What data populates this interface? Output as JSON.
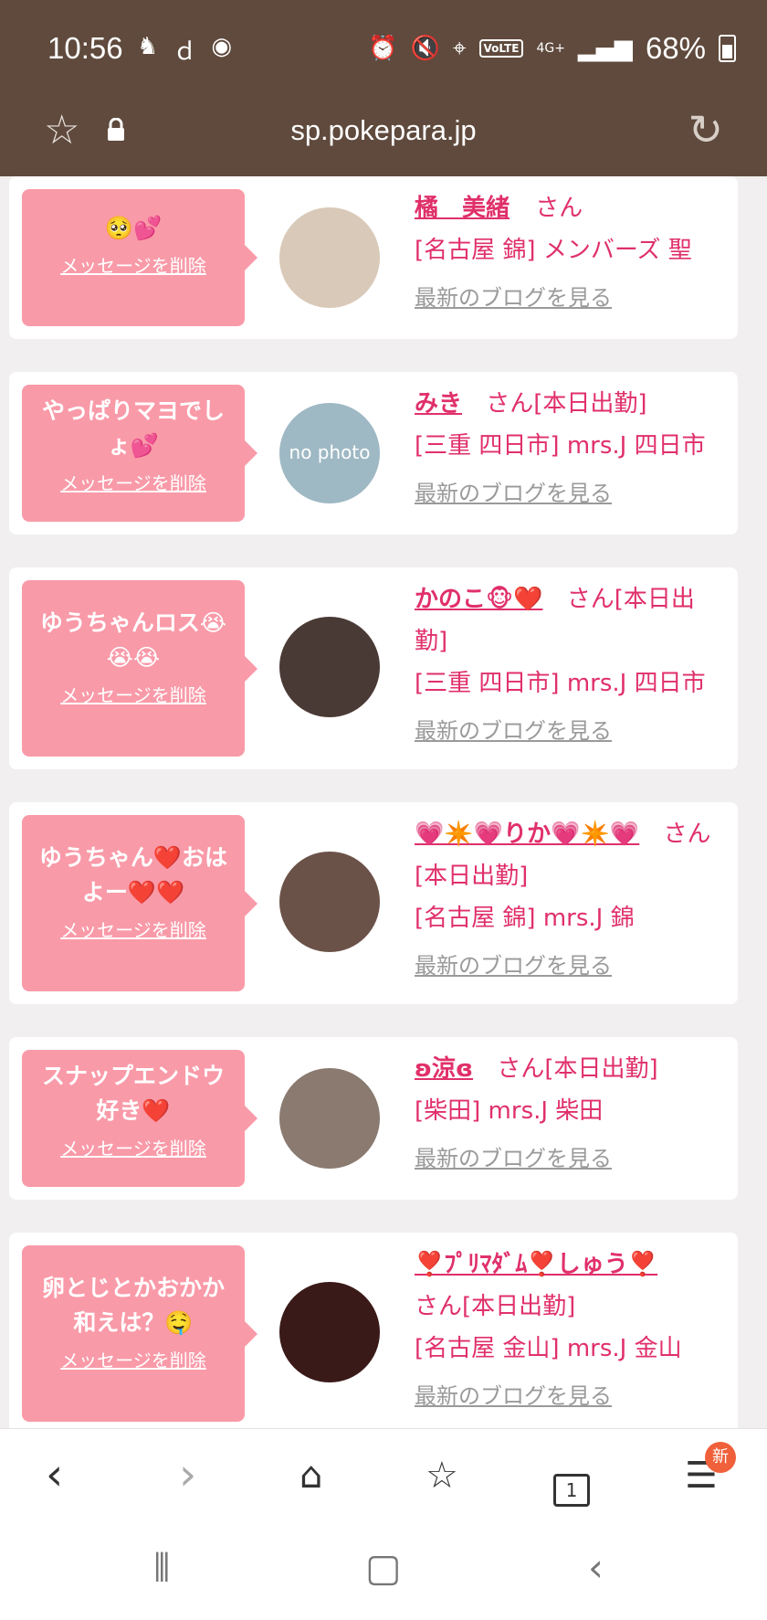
{
  "status": {
    "time": "10:56",
    "volte": "VoLTE",
    "network": "4G+",
    "battery": "68%"
  },
  "browser": {
    "url": "sp.pokepara.jp",
    "tab_count": "1",
    "menu_badge": "新"
  },
  "delete_label": "メッセージを削除",
  "blog_label": "最新のブログを見る",
  "san": "さん",
  "entries": [
    {
      "message": "🥺💕",
      "name": "橘　美緒",
      "name_tail": "さん",
      "shop": "[名古屋 錦] メンバーズ 聖",
      "avatar_color": "#d9c9b8",
      "avatar_text": ""
    },
    {
      "message": "やっぱりマヨでしょ💕",
      "name": "みき",
      "name_tail": "さん[本日出勤]",
      "shop": "[三重 四日市] mrs.J 四日市",
      "avatar_color": "#9eb8c4",
      "avatar_text": "no photo"
    },
    {
      "message": "ゆうちゃんロス😭😭😭",
      "name": "かのこ🐵❤️",
      "name_tail": "さん[本日出勤]",
      "shop": "[三重 四日市] mrs.J 四日市",
      "avatar_color": "#4a3a35",
      "avatar_text": ""
    },
    {
      "message": "ゆうちゃん❤️おはよー❤️❤️",
      "name": "💗✴️💗りか💗✴️💗",
      "name_tail": "さん[本日出勤]",
      "shop": "[名古屋 錦] mrs.J 錦",
      "avatar_color": "#6b5248",
      "avatar_text": ""
    },
    {
      "message": "スナップエンドウ好き❤️",
      "name": "ʚ涼ɞ",
      "name_tail": "さん[本日出勤]",
      "shop": "[柴田] mrs.J 柴田",
      "avatar_color": "#8a7a70",
      "avatar_text": ""
    },
    {
      "message": "卵とじとかおかか和えは？🤤",
      "name": "❣️ﾌﾟﾘﾏﾀﾞﾑ❣️しゅう❣️",
      "name_tail": "さん[本日出勤]",
      "shop": "[名古屋 金山] mrs.J 金山",
      "avatar_color": "#3a1a18",
      "avatar_text": ""
    }
  ]
}
